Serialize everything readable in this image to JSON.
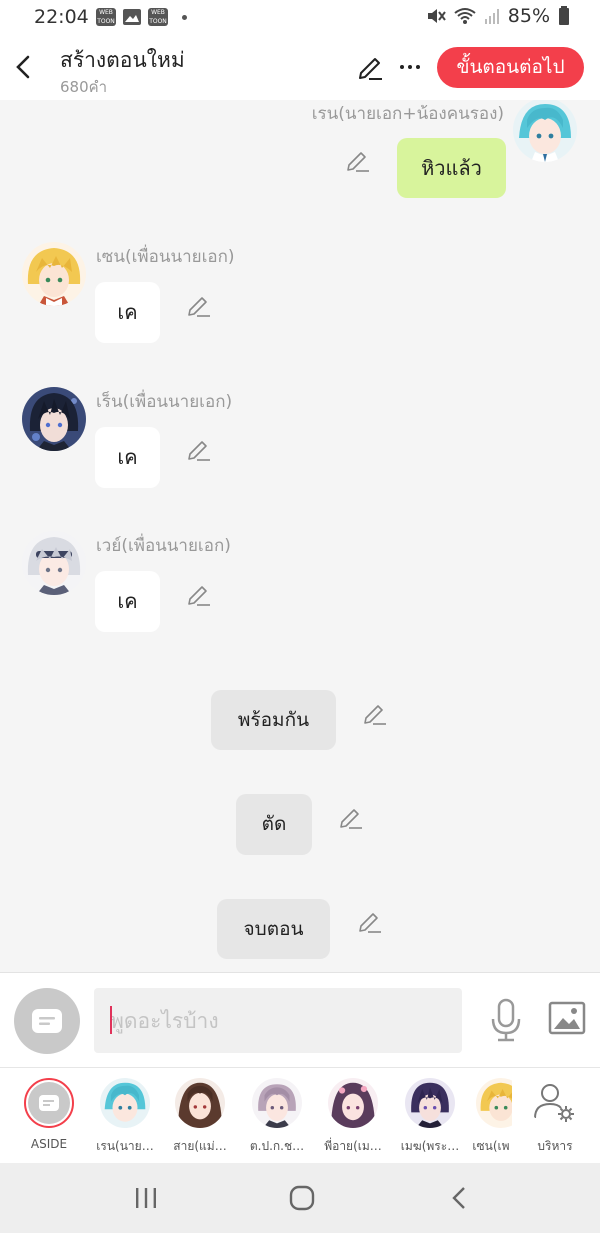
{
  "status_bar": {
    "time": "22:04",
    "notif_icons": [
      "webtoon-icon",
      "image-icon",
      "webtoon-icon"
    ],
    "notif_labels": [
      "WEB TOON",
      "WEB TOON"
    ],
    "battery": "85%"
  },
  "header": {
    "title": "สร้างตอนใหม่",
    "subtitle": "680คำ",
    "next_button": "ขั้นตอนต่อไป"
  },
  "messages": [
    {
      "speaker": "เรน(นายเอก+น้องคนรอง)",
      "text": "หิวแล้ว",
      "side": "right"
    },
    {
      "speaker": "เซน(เพื่อนนายเอก)",
      "text": "เค",
      "side": "left"
    },
    {
      "speaker": "เร็น(เพื่อนนายเอก)",
      "text": "เค",
      "side": "left"
    },
    {
      "speaker": "เวย์(เพื่อนนายเอก)",
      "text": "เค",
      "side": "left"
    }
  ],
  "system_messages": [
    "พร้อมกัน",
    "ตัด",
    "จบตอน"
  ],
  "input": {
    "placeholder": "พูดอะไรบ้าง",
    "value": ""
  },
  "characters": [
    {
      "label": "ASIDE"
    },
    {
      "label": "เรน(นาย…"
    },
    {
      "label": "สาย(แม่…"
    },
    {
      "label": "ต.ป.ก.ช…"
    },
    {
      "label": "พี่อาย(เม…"
    },
    {
      "label": "เมฆ(พระ…"
    },
    {
      "label": "เซน(เพ"
    },
    {
      "label": "บริหาร"
    }
  ],
  "colors": {
    "accent": "#f33f4b",
    "my_bubble": "#d8f49c",
    "system_bubble": "#e6e6e6",
    "chat_bg": "#f5f5f5"
  }
}
